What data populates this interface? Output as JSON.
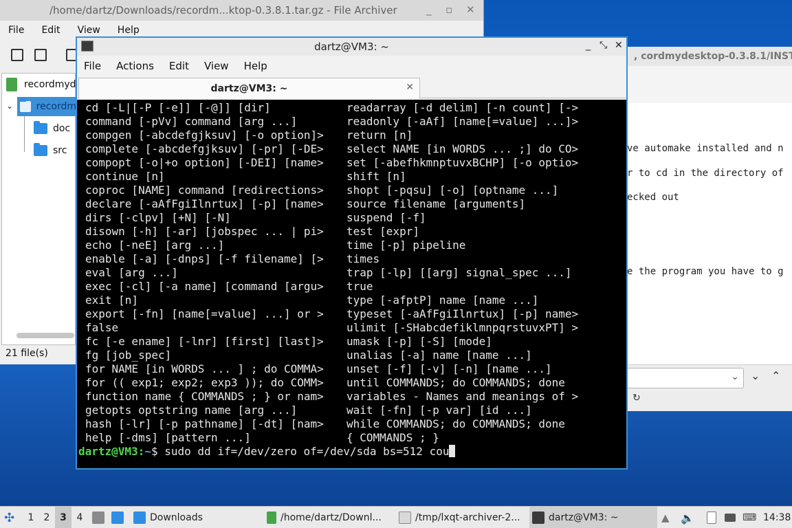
{
  "archiver": {
    "title": "/home/dartz/Downloads/recordm...ktop-0.3.8.1.tar.gz - File Archiver",
    "menu": [
      "File",
      "Edit",
      "View",
      "Help"
    ],
    "tree": {
      "root": "recordmyd",
      "selected": "recordm",
      "children": [
        "doc",
        "src"
      ]
    },
    "status": "21 file(s)"
  },
  "bgwindow": {
    "title": ", cordmydesktop-0.3.8.1/INST",
    "lines": [
      "ve automake installed and n",
      "r to cd in the directory of",
      "ecked out",
      "e the program you have to g"
    ]
  },
  "terminal": {
    "title": "dartz@VM3: ~",
    "menu": [
      "File",
      "Actions",
      "Edit",
      "View",
      "Help"
    ],
    "tab_label": "dartz@VM3: ~",
    "left_col": [
      "cd [-L|[-P [-e]] [-@]] [dir]",
      "command [-pVv] command [arg ...]",
      "compgen [-abcdefgjksuv] [-o option]>",
      "complete [-abcdefgjksuv] [-pr] [-DE>",
      "compopt [-o|+o option] [-DEI] [name>",
      "continue [n]",
      "coproc [NAME] command [redirections>",
      "declare [-aAfFgiIlnrtux] [-p] [name>",
      "dirs [-clpv] [+N] [-N]",
      "disown [-h] [-ar] [jobspec ... | pi>",
      "echo [-neE] [arg ...]",
      "enable [-a] [-dnps] [-f filename] [>",
      "eval [arg ...]",
      "exec [-cl] [-a name] [command [argu>",
      "exit [n]",
      "export [-fn] [name[=value] ...] or >",
      "false",
      "fc [-e ename] [-lnr] [first] [last]>",
      "fg [job_spec]",
      "for NAME [in WORDS ... ] ; do COMMA>",
      "for (( exp1; exp2; exp3 )); do COMM>",
      "function name { COMMANDS ; } or nam>",
      "getopts optstring name [arg ...]",
      "hash [-lr] [-p pathname] [-dt] [nam>",
      "help [-dms] [pattern ...]"
    ],
    "right_col": [
      "readarray [-d delim] [-n count] [->",
      "readonly [-aAf] [name[=value] ...]>",
      "return [n]",
      "select NAME [in WORDS ... ;] do CO>",
      "set [-abefhkmnptuvxBCHP] [-o optio>",
      "shift [n]",
      "shopt [-pqsu] [-o] [optname ...]",
      "source filename [arguments]",
      "suspend [-f]",
      "test [expr]",
      "time [-p] pipeline",
      "times",
      "trap [-lp] [[arg] signal_spec ...]",
      "true",
      "type [-afptP] name [name ...]",
      "typeset [-aAfFgiIlnrtux] [-p] name>",
      "ulimit [-SHabcdefiklmnpqrstuvxPT] >",
      "umask [-p] [-S] [mode]",
      "unalias [-a] name [name ...]",
      "unset [-f] [-v] [-n] [name ...]",
      "until COMMANDS; do COMMANDS; done",
      "variables - Names and meanings of >",
      "wait [-fn] [-p var] [id ...]",
      "while COMMANDS; do COMMANDS; done",
      "{ COMMANDS ; }"
    ],
    "prompt_user": "dartz@VM3",
    "prompt_sep": ":",
    "prompt_path": "~",
    "prompt_end": "$ ",
    "command": "sudo dd if=/dev/zero of=/dev/sda bs=512 cou"
  },
  "taskbar": {
    "desktops": [
      "1",
      "2",
      "3",
      "4"
    ],
    "active_desktop": "3",
    "tasks": [
      {
        "label": "Downloads",
        "icon": "folder-icon"
      },
      {
        "label": "/home/dartz/Downl...",
        "icon": "archive-icon"
      },
      {
        "label": "/tmp/lxqt-archiver-2...",
        "icon": "text-editor-icon"
      },
      {
        "label": "dartz@VM3: ~",
        "icon": "terminal-icon"
      }
    ],
    "clock": "14:38"
  },
  "colors": {
    "prompt_user": "#4fd84f",
    "prompt_path": "#5a9cf2",
    "active_border": "#3b8fd9",
    "selection": "#3b8fd9"
  }
}
